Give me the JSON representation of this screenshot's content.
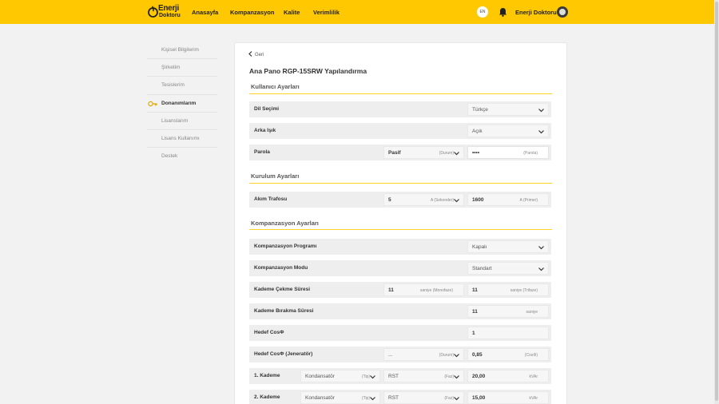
{
  "brand": {
    "logo_line1": "Enerji",
    "logo_line2": "Doktoru",
    "accent": "#ffc800",
    "section_line": "#ffd32a"
  },
  "nav": {
    "items": [
      "Anasayfa",
      "Kompanzasyon",
      "Kalite",
      "Verimlilik"
    ]
  },
  "header": {
    "lang": "EN",
    "username": "Enerji Doktoru"
  },
  "sidebar": {
    "items": [
      {
        "label": "Kişisel Bilgilerim"
      },
      {
        "label": "Şirketim"
      },
      {
        "label": "Tesislerim"
      },
      {
        "label": "Donanımlarım",
        "icon": "key-icon",
        "active": true
      },
      {
        "label": "Lisanslarım"
      },
      {
        "label": "Lisans Kullanımı"
      },
      {
        "label": "Destek"
      }
    ]
  },
  "main": {
    "back": "Geri",
    "title": "Ana Pano RGP-15SRW Yapılandırma",
    "sections": [
      {
        "title": "Kullanıcı Ayarları"
      },
      {
        "title": "Kurulum Ayarları"
      },
      {
        "title": "Kompanzasyon Ayarları"
      }
    ],
    "rows": {
      "dil": {
        "label": "Dil Seçimi",
        "value": "Türkçe"
      },
      "arka": {
        "label": "Arka Işık",
        "value": "Açık"
      },
      "parola": {
        "label": "Parola",
        "value1": "Pasif",
        "unit1": "(Durum)",
        "value2": "••••",
        "unit2": "(Parola)"
      },
      "akim": {
        "label": "Akım Trafosu",
        "value1": "5",
        "unit1": "A (Sekonder)",
        "value2": "1600",
        "unit2": "A (Primer)"
      },
      "program": {
        "label": "Kompanzasyon Programı",
        "value": "Kapalı"
      },
      "modu": {
        "label": "Kompanzasyon Modu",
        "value": "Standart"
      },
      "cekme": {
        "label": "Kademe Çekme Süresi",
        "value1": "11",
        "unit1": "saniye (Monofaze)",
        "value2": "11",
        "unit2": "saniye (Trifaze)"
      },
      "birakma": {
        "label": "Kademe Bırakma Süresi",
        "value2": "11",
        "unit2": "saniye"
      },
      "hedef": {
        "label": "Hedef CosΦ",
        "value2": "1"
      },
      "hedefj": {
        "label": "Hedef CosΦ (Jeneratör)",
        "value1": "...",
        "unit1": "(Durum)",
        "value2": "0,85",
        "unit2": "(CosΦ)"
      },
      "k1": {
        "label": "1. Kademe",
        "type": "Kondansatör",
        "type_unit": "(Tip)",
        "phase": "RST",
        "phase_unit": "(Faz)",
        "value": "20,00",
        "unit": "kVAr"
      },
      "k2": {
        "label": "2. Kademe",
        "type": "Kondansatör",
        "type_unit": "(Tip)",
        "phase": "RST",
        "phase_unit": "(Faz)",
        "value": "15,00",
        "unit": "kVAr"
      }
    }
  }
}
